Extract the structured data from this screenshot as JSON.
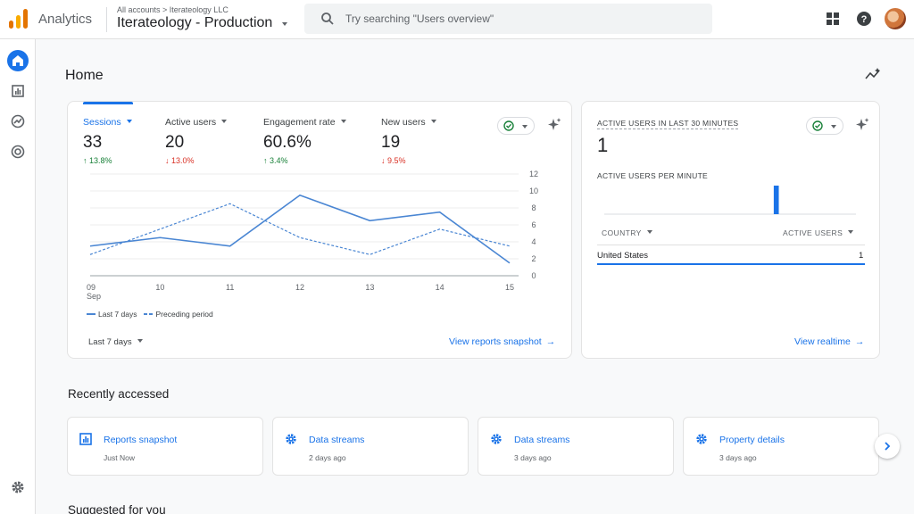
{
  "app": {
    "name": "Analytics"
  },
  "account": {
    "path": "All accounts > Iterateology LLC",
    "property": "Iterateology - Production"
  },
  "search": {
    "placeholder": "Try searching \"Users overview\""
  },
  "page": {
    "title": "Home"
  },
  "metrics": [
    {
      "label": "Sessions",
      "value": "33",
      "change": "↑ 13.8%",
      "direction": "up"
    },
    {
      "label": "Active users",
      "value": "20",
      "change": "↓ 13.0%",
      "direction": "down"
    },
    {
      "label": "Engagement rate",
      "value": "60.6%",
      "change": "↑ 3.4%",
      "direction": "up"
    },
    {
      "label": "New users",
      "value": "19",
      "change": "↓ 9.5%",
      "direction": "down"
    }
  ],
  "chart_data": {
    "type": "line",
    "x": [
      "09",
      "10",
      "11",
      "12",
      "13",
      "14",
      "15"
    ],
    "x_month": "Sep",
    "ylim": [
      0,
      12
    ],
    "yticks": [
      "0",
      "2",
      "4",
      "6",
      "8",
      "10",
      "12"
    ],
    "series": [
      {
        "name": "Last 7 days",
        "values": [
          3.5,
          4.5,
          3.5,
          9.5,
          6.5,
          7.5,
          1.5
        ]
      },
      {
        "name": "Preceding period",
        "values": [
          2.5,
          5.5,
          8.5,
          4.5,
          2.5,
          5.5,
          3.5
        ]
      }
    ],
    "grid": true
  },
  "overview_card": {
    "date_range": "Last 7 days",
    "link": "View reports snapshot"
  },
  "realtime": {
    "label": "ACTIVE USERS IN LAST 30 MINUTES",
    "value": "1",
    "sub_label": "ACTIVE USERS PER MINUTE",
    "col_country": "COUNTRY",
    "col_users": "ACTIVE USERS",
    "rows": [
      {
        "country": "United States",
        "users": "1"
      }
    ],
    "link": "View realtime",
    "per_minute": [
      0,
      0,
      0,
      0,
      0,
      0,
      0,
      0,
      0,
      0,
      0,
      0,
      0,
      0,
      0,
      0,
      0,
      0,
      0,
      0,
      1,
      0,
      0,
      0,
      0,
      0,
      0,
      0,
      0,
      0
    ]
  },
  "recent": {
    "title": "Recently accessed",
    "items": [
      {
        "title": "Reports snapshot",
        "time": "Just Now",
        "icon": "report-icon"
      },
      {
        "title": "Data streams",
        "time": "2 days ago",
        "icon": "gear-icon"
      },
      {
        "title": "Data streams",
        "time": "3 days ago",
        "icon": "gear-icon"
      },
      {
        "title": "Property details",
        "time": "3 days ago",
        "icon": "gear-icon"
      }
    ]
  },
  "suggested": {
    "title": "Suggested for you"
  },
  "colors": {
    "accent": "#1a73e8",
    "line": "#4a86d3",
    "up": "#188038",
    "down": "#d93025"
  }
}
